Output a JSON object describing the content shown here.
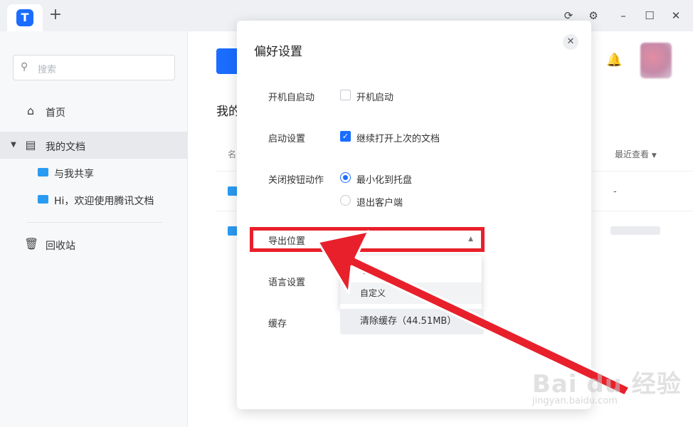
{
  "app": {
    "logo_icon": "tencent-docs-logo-icon",
    "tab_add_label": "+"
  },
  "sidebar": {
    "search_placeholder": "搜索",
    "items": [
      {
        "label": "首页",
        "icon": "home-icon"
      },
      {
        "label": "我的文档",
        "icon": "document-icon"
      },
      {
        "label": "与我共享",
        "icon": "shared-folder-icon"
      },
      {
        "label": "Hi，欢迎使用腾讯文档",
        "icon": "folder-icon"
      },
      {
        "label": "回收站",
        "icon": "trash-icon"
      }
    ]
  },
  "main": {
    "title": "我的",
    "col_name": "名",
    "col_recent": "最近查看",
    "row1_recent": "-"
  },
  "dialog": {
    "title": "偏好设置",
    "close_label": "✕",
    "autostart_label": "开机自启动",
    "autostart_option": "开机启动",
    "startup_label": "启动设置",
    "startup_option": "继续打开上次的文档",
    "close_action_label": "关闭按钮动作",
    "close_action_options": [
      "最小化到托盘",
      "退出客户端"
    ],
    "export_label": "导出位置",
    "language_label": "语言设置",
    "dropdown_items": [
      "下",
      "自定义"
    ],
    "cache_label": "缓存",
    "cache_button": "清除缓存（44.51MB）"
  },
  "watermark": {
    "logo": "Bai du 经验",
    "text": "jingyan.baidu.com"
  },
  "colors": {
    "accent": "#1a6dff",
    "annotation": "#e8202b"
  }
}
